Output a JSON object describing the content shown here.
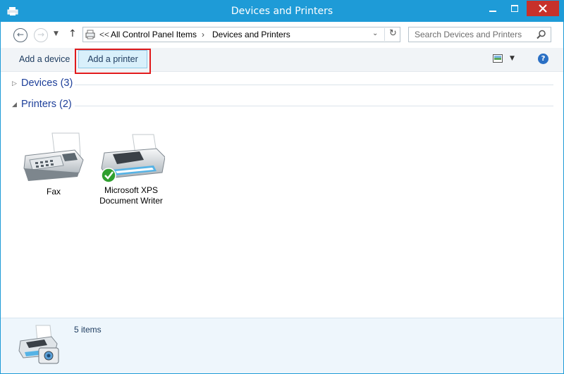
{
  "window": {
    "title": "Devices and Printers"
  },
  "addressbar": {
    "breadcrumb": [
      "All Control Panel Items",
      "Devices and Printers"
    ],
    "overflow": "<<",
    "search_placeholder": "Search Devices and Printers"
  },
  "toolbar": {
    "add_device": "Add a device",
    "add_printer": "Add a printer",
    "help": "?"
  },
  "groups": [
    {
      "label": "Devices (3)",
      "expanded": false
    },
    {
      "label": "Printers (2)",
      "expanded": true
    }
  ],
  "printers": [
    {
      "label_lines": [
        "Fax"
      ],
      "icon": "fax-icon"
    },
    {
      "label_lines": [
        "Microsoft XPS",
        "Document Writer"
      ],
      "icon": "printer-icon",
      "default": true
    }
  ],
  "status": {
    "count": "5 items"
  },
  "colors": {
    "titlebar": "#1e9bd7",
    "close": "#c7312a",
    "highlight": "#e0191b",
    "link": "#1d3f9a"
  }
}
